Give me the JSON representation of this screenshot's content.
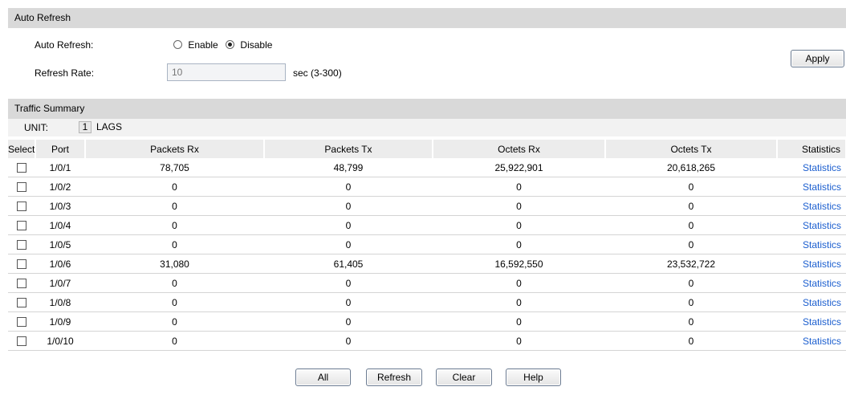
{
  "auto_refresh": {
    "header": "Auto Refresh",
    "auto_refresh_label": "Auto Refresh:",
    "enable_label": "Enable",
    "disable_label": "Disable",
    "selected": "Disable",
    "refresh_rate_label": "Refresh Rate:",
    "refresh_rate_value": "10",
    "refresh_rate_unit": "sec (3-300)",
    "apply_label": "Apply"
  },
  "traffic_summary": {
    "header": "Traffic Summary",
    "unit_label": "UNIT:",
    "unit_value": "1",
    "lags_label": "LAGS",
    "columns": [
      "Select",
      "Port",
      "Packets Rx",
      "Packets Tx",
      "Octets Rx",
      "Octets Tx",
      "Statistics"
    ],
    "rows": [
      {
        "port": "1/0/1",
        "packets_rx": "78,705",
        "packets_tx": "48,799",
        "octets_rx": "25,922,901",
        "octets_tx": "20,618,265",
        "stat": "Statistics"
      },
      {
        "port": "1/0/2",
        "packets_rx": "0",
        "packets_tx": "0",
        "octets_rx": "0",
        "octets_tx": "0",
        "stat": "Statistics"
      },
      {
        "port": "1/0/3",
        "packets_rx": "0",
        "packets_tx": "0",
        "octets_rx": "0",
        "octets_tx": "0",
        "stat": "Statistics"
      },
      {
        "port": "1/0/4",
        "packets_rx": "0",
        "packets_tx": "0",
        "octets_rx": "0",
        "octets_tx": "0",
        "stat": "Statistics"
      },
      {
        "port": "1/0/5",
        "packets_rx": "0",
        "packets_tx": "0",
        "octets_rx": "0",
        "octets_tx": "0",
        "stat": "Statistics"
      },
      {
        "port": "1/0/6",
        "packets_rx": "31,080",
        "packets_tx": "61,405",
        "octets_rx": "16,592,550",
        "octets_tx": "23,532,722",
        "stat": "Statistics"
      },
      {
        "port": "1/0/7",
        "packets_rx": "0",
        "packets_tx": "0",
        "octets_rx": "0",
        "octets_tx": "0",
        "stat": "Statistics"
      },
      {
        "port": "1/0/8",
        "packets_rx": "0",
        "packets_tx": "0",
        "octets_rx": "0",
        "octets_tx": "0",
        "stat": "Statistics"
      },
      {
        "port": "1/0/9",
        "packets_rx": "0",
        "packets_tx": "0",
        "octets_rx": "0",
        "octets_tx": "0",
        "stat": "Statistics"
      },
      {
        "port": "1/0/10",
        "packets_rx": "0",
        "packets_tx": "0",
        "octets_rx": "0",
        "octets_tx": "0",
        "stat": "Statistics"
      }
    ]
  },
  "buttons": {
    "all": "All",
    "refresh": "Refresh",
    "clear": "Clear",
    "help": "Help"
  },
  "colors": {
    "header_bg": "#d9d9d9",
    "link": "#1c5fcf"
  }
}
